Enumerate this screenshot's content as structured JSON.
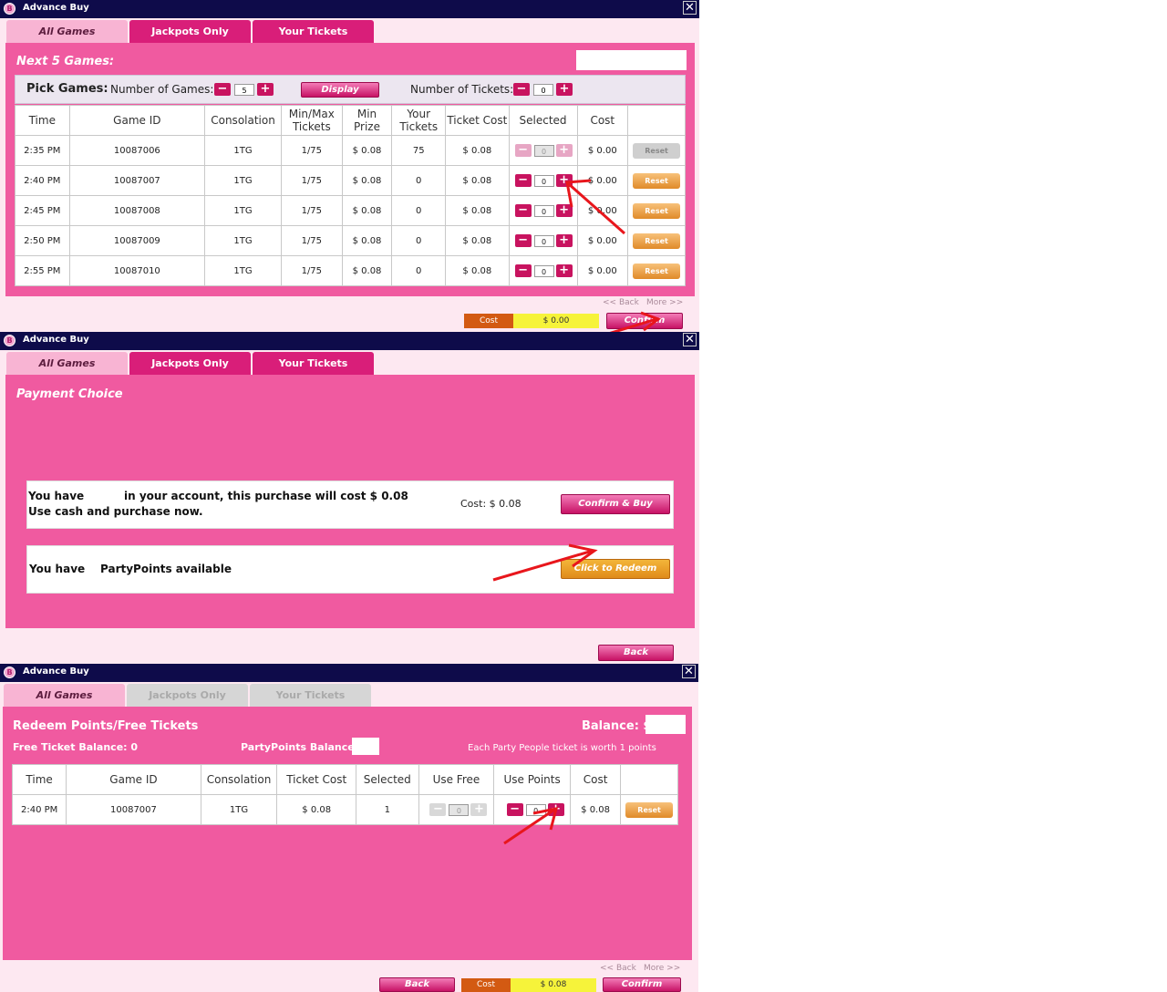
{
  "colors": {
    "titlebar": "#0e0b4a",
    "panel": "#f05aa0",
    "tab_active": "#f8b4d3",
    "tab_inactive": "#d91e79",
    "accent": "#c8135f",
    "reset": "#e08a29",
    "cost_label": "#d35a12",
    "cost_value": "#f6f33a",
    "arrow": "#e8161c"
  },
  "w1": {
    "title": "Advance Buy",
    "close": "✕",
    "tabs": [
      "All Games",
      "Jackpots Only",
      "Your Tickets"
    ],
    "heading": "Next 5 Games:",
    "pick_games": "Pick Games:",
    "num_games_label": "Number of Games:",
    "num_games_value": "5",
    "display_btn": "Display",
    "num_tickets_label": "Number of Tickets:",
    "num_tickets_value": "0",
    "minus": "−",
    "plus": "+",
    "headers": [
      "Time",
      "Game ID",
      "Consolation",
      "Min/Max Tickets",
      "Min Prize",
      "Your Tickets",
      "Ticket Cost",
      "Selected",
      "Cost",
      ""
    ],
    "rows": [
      {
        "time": "2:35 PM",
        "game_id": "10087006",
        "consolation": "1TG",
        "minmax": "1/75",
        "min_prize": "$ 0.08",
        "your_tickets": "75",
        "ticket_cost": "$ 0.08",
        "selected": "0",
        "cost": "$ 0.00",
        "reset": "Reset"
      },
      {
        "time": "2:40 PM",
        "game_id": "10087007",
        "consolation": "1TG",
        "minmax": "1/75",
        "min_prize": "$ 0.08",
        "your_tickets": "0",
        "ticket_cost": "$ 0.08",
        "selected": "0",
        "cost": "$ 0.00",
        "reset": "Reset"
      },
      {
        "time": "2:45 PM",
        "game_id": "10087008",
        "consolation": "1TG",
        "minmax": "1/75",
        "min_prize": "$ 0.08",
        "your_tickets": "0",
        "ticket_cost": "$ 0.08",
        "selected": "0",
        "cost": "$ 0.00",
        "reset": "Reset"
      },
      {
        "time": "2:50 PM",
        "game_id": "10087009",
        "consolation": "1TG",
        "minmax": "1/75",
        "min_prize": "$ 0.08",
        "your_tickets": "0",
        "ticket_cost": "$ 0.08",
        "selected": "0",
        "cost": "$ 0.00",
        "reset": "Reset"
      },
      {
        "time": "2:55 PM",
        "game_id": "10087010",
        "consolation": "1TG",
        "minmax": "1/75",
        "min_prize": "$ 0.08",
        "your_tickets": "0",
        "ticket_cost": "$ 0.08",
        "selected": "0",
        "cost": "$ 0.00",
        "reset": "Reset"
      }
    ],
    "back": "<< Back",
    "more": "More >>",
    "cost_label": "Cost",
    "cost_value": "$ 0.00",
    "confirm": "Confirm"
  },
  "w2": {
    "title": "Advance Buy",
    "close": "✕",
    "tabs": [
      "All Games",
      "Jackpots Only",
      "Your Tickets"
    ],
    "heading": "Payment Choice",
    "cash_line1_a": "You have",
    "cash_line1_b": "in your account, this purchase will cost $ 0.08",
    "cash_line2": "Use cash and purchase now.",
    "cash_cost": "Cost: $ 0.08",
    "confirm_buy": "Confirm & Buy",
    "points_a": "You have",
    "points_b": "PartyPoints available",
    "redeem": "Click to Redeem",
    "back": "Back"
  },
  "w3": {
    "title": "Advance Buy",
    "close": "✕",
    "tabs": [
      "All Games",
      "Jackpots Only",
      "Your Tickets"
    ],
    "heading": "Redeem Points/Free Tickets",
    "balance_label": "Balance: $",
    "free_balance": "Free Ticket Balance: 0",
    "pp_balance": "PartyPoints Balance:",
    "worth_note": "Each Party People ticket is worth 1 points",
    "headers": [
      "Time",
      "Game ID",
      "Consolation",
      "Ticket Cost",
      "Selected",
      "Use Free",
      "Use Points",
      "Cost",
      ""
    ],
    "row": {
      "time": "2:40 PM",
      "game_id": "10087007",
      "consolation": "1TG",
      "ticket_cost": "$ 0.08",
      "selected": "1",
      "use_free": "0",
      "use_points": "0",
      "cost": "$ 0.08",
      "reset": "Reset"
    },
    "minus": "−",
    "plus": "+",
    "back_link": "<< Back",
    "more_link": "More >>",
    "back": "Back",
    "cost_label": "Cost",
    "cost_value": "$ 0.08",
    "confirm": "Confirm"
  }
}
